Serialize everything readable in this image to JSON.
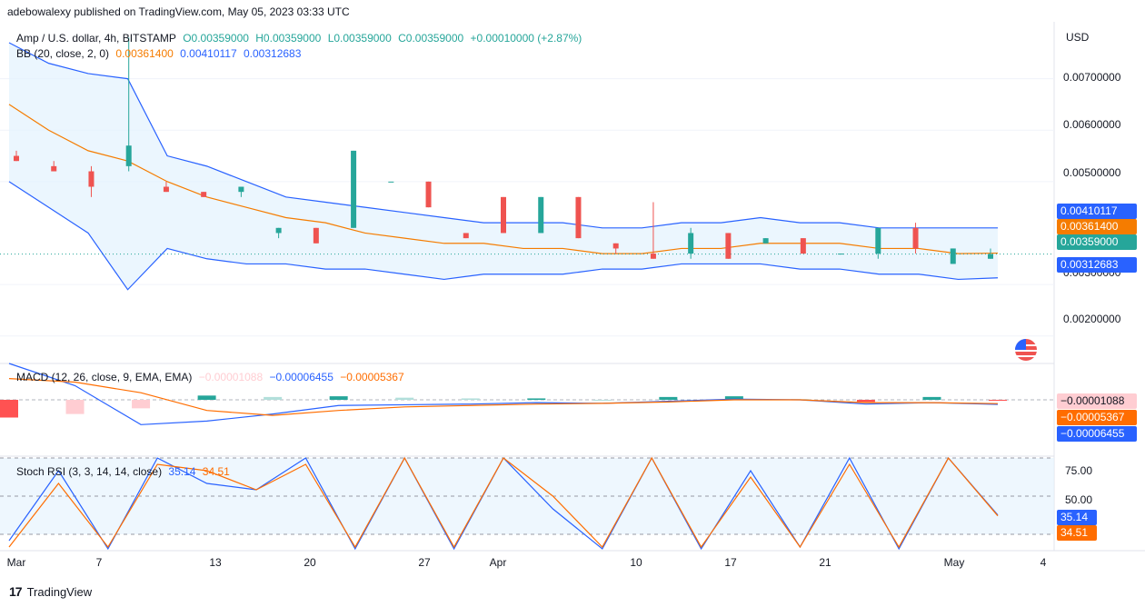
{
  "publisher": "adebowalexy published on TradingView.com, May 05, 2023 03:33 UTC",
  "main_legend": {
    "symbol": "Amp / U.S. dollar, 4h, BITSTAMP",
    "open": "O0.00359000",
    "high": "H0.00359000",
    "low": "L0.00359000",
    "close": "C0.00359000",
    "change": "+0.00010000 (+2.87%)"
  },
  "bb_legend": {
    "label": "BB (20, close, 2, 0)",
    "basis": "0.00361400",
    "upper": "0.00410117",
    "lower": "0.00312683"
  },
  "macd_legend": {
    "label": "MACD (12, 26, close, 9, EMA, EMA)",
    "hist": "−0.00001088",
    "macd": "−0.00006455",
    "signal": "−0.00005367"
  },
  "rsi_legend": {
    "label": "Stoch RSI (3, 3, 14, 14, close)",
    "k": "35.14",
    "d": "34.51"
  },
  "currency": "USD",
  "price_axis_labels": [
    "0.00700000",
    "0.00600000",
    "0.00500000",
    "0.00300000",
    "0.00200000"
  ],
  "price_badges": {
    "upper": "0.00410117",
    "basis": "0.00361400",
    "last": "0.00359000",
    "lower": "0.00312683"
  },
  "macd_badges": {
    "hist": "−0.00001088",
    "signal": "−0.00005367",
    "macd": "−0.00006455"
  },
  "rsi_axis_labels": [
    "75.00",
    "50.00"
  ],
  "rsi_badges": {
    "k": "35.14",
    "d": "34.51"
  },
  "time_axis_labels": [
    "Mar",
    "7",
    "13",
    "20",
    "27",
    "Apr",
    "10",
    "17",
    "21",
    "May",
    "4"
  ],
  "footer_brand": "TradingView",
  "colors": {
    "up": "#26a69a",
    "down": "#ef5350",
    "bb_band": "#2962ff",
    "bb_basis": "#f57c00",
    "bb_fill": "#e3f2fd",
    "macd_line": "#2962ff",
    "signal_line": "#ff6d00",
    "hist_up_strong": "#26a69a",
    "hist_up_weak": "#b2dfdb",
    "hist_down_strong": "#ff5252",
    "hist_down_weak": "#ffcdd2",
    "stoch_k": "#2962ff",
    "stoch_d": "#ff6d00"
  },
  "chart_data": [
    {
      "type": "candlestick",
      "title": "Amp / U.S. dollar, 4h, BITSTAMP",
      "ylabel": "USD",
      "ylim": [
        0.0015,
        0.008
      ],
      "x_ticks": [
        "Mar",
        "7",
        "13",
        "20",
        "27",
        "Apr",
        "10",
        "17",
        "21",
        "May",
        "4"
      ],
      "last_close": 0.00359,
      "bollinger": {
        "basis": 0.003614,
        "upper": 0.00410117,
        "lower": 0.00312683
      },
      "basis_series": [
        0.0065,
        0.006,
        0.0056,
        0.0054,
        0.005,
        0.0047,
        0.0045,
        0.0043,
        0.0042,
        0.004,
        0.0039,
        0.0038,
        0.0038,
        0.0037,
        0.0037,
        0.0036,
        0.0036,
        0.0037,
        0.0037,
        0.0038,
        0.0038,
        0.0038,
        0.0037,
        0.0037,
        0.0036,
        0.00361
      ],
      "upper_series": [
        0.0077,
        0.0073,
        0.0071,
        0.007,
        0.0055,
        0.0053,
        0.005,
        0.0047,
        0.0046,
        0.0045,
        0.0044,
        0.0043,
        0.0042,
        0.0042,
        0.0042,
        0.0041,
        0.0041,
        0.0042,
        0.0042,
        0.0043,
        0.0042,
        0.0042,
        0.0041,
        0.0041,
        0.0041,
        0.0041
      ],
      "lower_series": [
        0.005,
        0.0045,
        0.004,
        0.0029,
        0.0037,
        0.0035,
        0.0034,
        0.0034,
        0.0033,
        0.0033,
        0.0032,
        0.0031,
        0.0032,
        0.0032,
        0.0032,
        0.0033,
        0.0033,
        0.0034,
        0.0034,
        0.0034,
        0.0033,
        0.0033,
        0.0032,
        0.0032,
        0.0031,
        0.00313
      ],
      "candles": [
        {
          "o": 0.0055,
          "h": 0.0056,
          "l": 0.0054,
          "c": 0.0054
        },
        {
          "o": 0.0053,
          "h": 0.0054,
          "l": 0.0052,
          "c": 0.0052
        },
        {
          "o": 0.0052,
          "h": 0.0053,
          "l": 0.0047,
          "c": 0.0049
        },
        {
          "o": 0.0053,
          "h": 0.0078,
          "l": 0.0052,
          "c": 0.0057
        },
        {
          "o": 0.0049,
          "h": 0.005,
          "l": 0.0048,
          "c": 0.0048
        },
        {
          "o": 0.0048,
          "h": 0.0048,
          "l": 0.0047,
          "c": 0.0047
        },
        {
          "o": 0.0048,
          "h": 0.0049,
          "l": 0.0047,
          "c": 0.0049
        },
        {
          "o": 0.004,
          "h": 0.0041,
          "l": 0.0039,
          "c": 0.0041
        },
        {
          "o": 0.0041,
          "h": 0.0041,
          "l": 0.0038,
          "c": 0.0038
        },
        {
          "o": 0.0041,
          "h": 0.0056,
          "l": 0.0041,
          "c": 0.0056
        },
        {
          "o": 0.005,
          "h": 0.005,
          "l": 0.005,
          "c": 0.005
        },
        {
          "o": 0.005,
          "h": 0.005,
          "l": 0.0045,
          "c": 0.0045
        },
        {
          "o": 0.004,
          "h": 0.004,
          "l": 0.0039,
          "c": 0.0039
        },
        {
          "o": 0.0047,
          "h": 0.0047,
          "l": 0.004,
          "c": 0.004
        },
        {
          "o": 0.004,
          "h": 0.0047,
          "l": 0.004,
          "c": 0.0047
        },
        {
          "o": 0.0047,
          "h": 0.0047,
          "l": 0.0039,
          "c": 0.0039
        },
        {
          "o": 0.0038,
          "h": 0.0038,
          "l": 0.0036,
          "c": 0.0037
        },
        {
          "o": 0.0036,
          "h": 0.0046,
          "l": 0.0035,
          "c": 0.0035
        },
        {
          "o": 0.0036,
          "h": 0.0041,
          "l": 0.0035,
          "c": 0.004
        },
        {
          "o": 0.004,
          "h": 0.004,
          "l": 0.0035,
          "c": 0.0035
        },
        {
          "o": 0.0038,
          "h": 0.0039,
          "l": 0.0038,
          "c": 0.0039
        },
        {
          "o": 0.0039,
          "h": 0.0039,
          "l": 0.0036,
          "c": 0.0036
        },
        {
          "o": 0.0036,
          "h": 0.0036,
          "l": 0.0036,
          "c": 0.0036
        },
        {
          "o": 0.0036,
          "h": 0.0041,
          "l": 0.0035,
          "c": 0.0041
        },
        {
          "o": 0.0041,
          "h": 0.0042,
          "l": 0.0036,
          "c": 0.0037
        },
        {
          "o": 0.0034,
          "h": 0.0037,
          "l": 0.0034,
          "c": 0.0037
        },
        {
          "o": 0.0035,
          "h": 0.0037,
          "l": 0.0035,
          "c": 0.00359
        }
      ]
    },
    {
      "type": "line",
      "title": "MACD (12, 26, close, 9, EMA, EMA)",
      "series": [
        {
          "name": "MACD",
          "values": [
            0.00055,
            0.0002,
            -0.00035,
            -0.0003,
            -0.0002,
            -8e-05,
            -7e-05,
            -6e-05,
            -4e-05,
            -5e-05,
            -2e-05,
            1e-05,
            0.0,
            -6e-05,
            -4e-05,
            -6.455e-05
          ]
        },
        {
          "name": "Signal",
          "values": [
            0.0003,
            0.00025,
            0.0001,
            -0.00015,
            -0.00022,
            -0.00015,
            -0.0001,
            -8e-05,
            -6e-05,
            -5e-05,
            -3e-05,
            0.0,
            0.0,
            -4e-05,
            -4e-05,
            -5.367e-05
          ]
        },
        {
          "name": "Histogram",
          "values": [
            -0.00025,
            -0.0002,
            -0.00012,
            6e-05,
            4e-05,
            5e-05,
            3e-05,
            2e-05,
            2e-05,
            0.0,
            4e-05,
            5e-05,
            1e-05,
            -3e-05,
            4e-05,
            -1.088e-05
          ]
        }
      ]
    },
    {
      "type": "line",
      "title": "Stoch RSI (3, 3, 14, 14, close)",
      "ylim": [
        0,
        100
      ],
      "y_ticks": [
        75,
        50
      ],
      "series": [
        {
          "name": "K",
          "values": [
            15,
            70,
            5,
            90,
            60,
            55,
            80,
            5,
            90,
            5,
            100,
            40,
            5,
            95,
            5,
            70,
            10,
            85,
            5,
            80,
            35.14
          ]
        },
        {
          "name": "D",
          "values": [
            10,
            60,
            10,
            75,
            70,
            55,
            75,
            10,
            80,
            10,
            95,
            50,
            10,
            85,
            10,
            65,
            10,
            75,
            10,
            80,
            34.51
          ]
        }
      ]
    }
  ]
}
